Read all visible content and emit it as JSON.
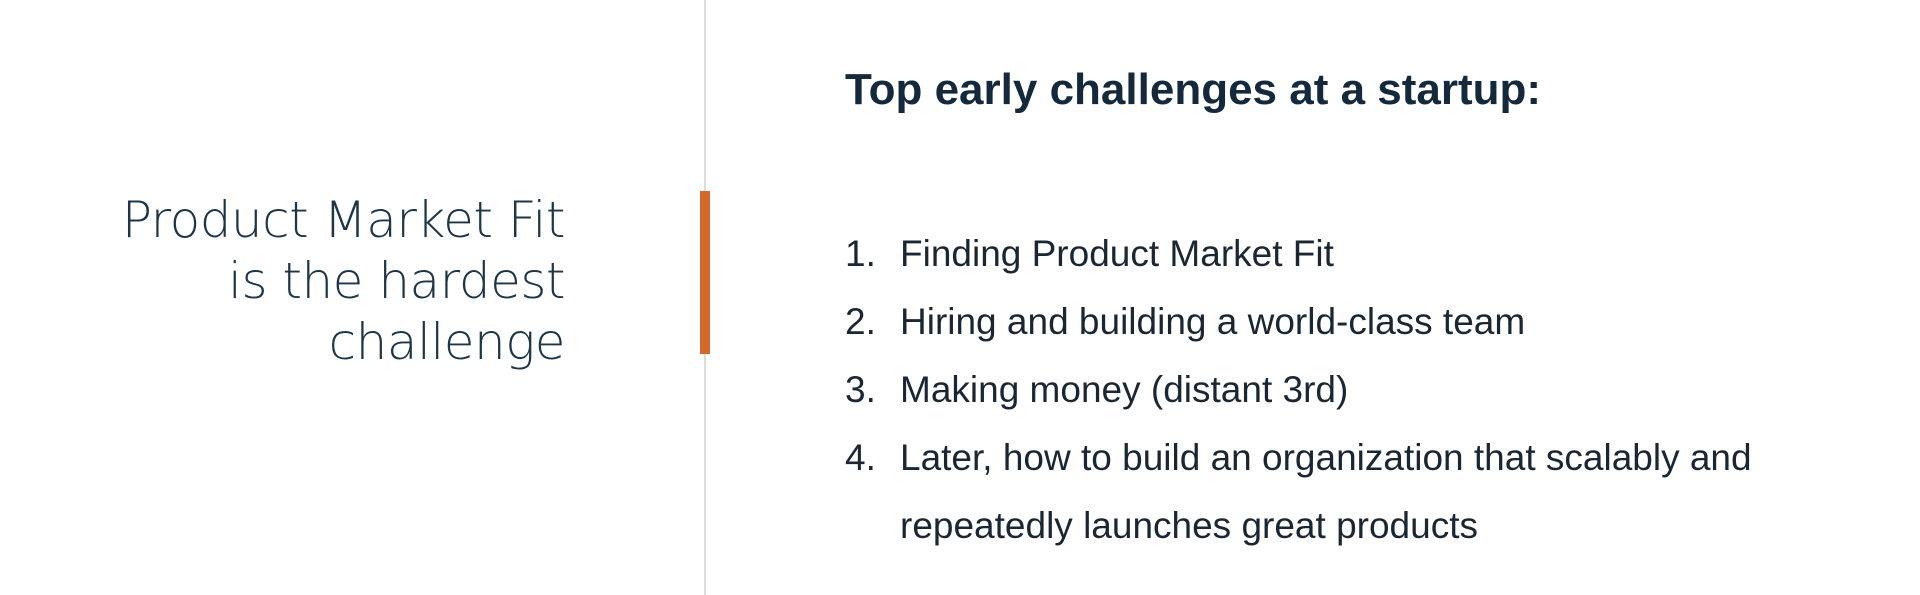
{
  "left": {
    "lines": [
      "Product Market Fit",
      "is the hardest",
      "challenge"
    ]
  },
  "right": {
    "title": "Top early challenges at a startup:",
    "items": [
      {
        "num": "1.",
        "text": "Finding Product Market Fit"
      },
      {
        "num": "2.",
        "text": "Hiring and building a world-class team"
      },
      {
        "num": "3.",
        "text": "Making money (distant 3rd)"
      },
      {
        "num": "4.",
        "text": "Later, how to build an organization that scalably and repeatedly launches great products"
      }
    ]
  },
  "colors": {
    "accent": "#d4692b",
    "heading": "#1d3546",
    "title": "#15293d",
    "body": "#1a2733",
    "divider": "#dcdcdc"
  }
}
